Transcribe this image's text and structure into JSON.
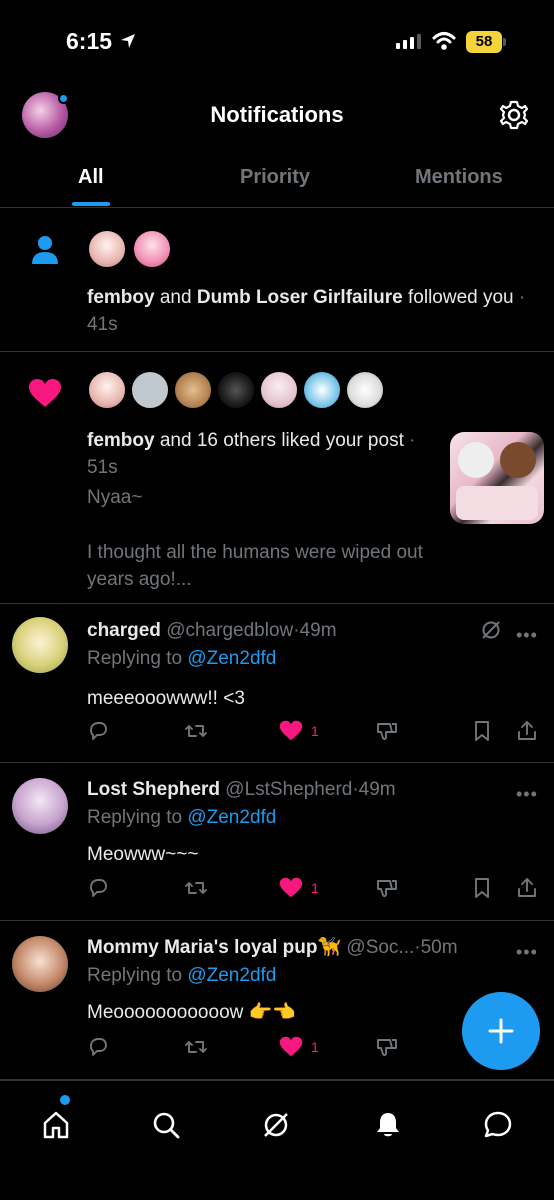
{
  "status_bar": {
    "time": "6:15",
    "battery": "58"
  },
  "header": {
    "title": "Notifications"
  },
  "tabs": [
    {
      "label": "All",
      "active": true
    },
    {
      "label": "Priority",
      "active": false
    },
    {
      "label": "Mentions",
      "active": false
    }
  ],
  "notifications": [
    {
      "type": "follow",
      "icon": "person-icon",
      "actor1": "femboy",
      "connector": " and ",
      "actor2": "Dumb Loser Girlfailure",
      "action": " followed you",
      "time": " · 41s"
    },
    {
      "type": "like",
      "icon": "heart-icon",
      "actor1": "femboy",
      "action": " and 16 others liked your post",
      "time": " · 51s",
      "post_text_1": "Nyaa~",
      "post_text_2": "I thought all the humans were wiped out years ago!..."
    }
  ],
  "replies": [
    {
      "name": "charged",
      "handle": "@chargedblow",
      "time": "·49m",
      "replying_label": "Replying to ",
      "replying_to": "@Zen2dfd",
      "text": "meeeooowww!! <3",
      "likes": "1"
    },
    {
      "name": "Lost Shepherd",
      "handle": "@LstShepherd",
      "time": "·49m",
      "replying_label": "Replying to ",
      "replying_to": "@Zen2dfd",
      "text": "Meowww~~~",
      "likes": "1"
    },
    {
      "name": "Mommy Maria's loyal pup🦮",
      "handle": "@Soc...",
      "time": "·50m",
      "replying_label": "Replying to ",
      "replying_to": "@Zen2dfd",
      "text": "Meooooooooooow 👉👈",
      "likes": "1"
    }
  ],
  "bottom_nav": [
    "home-icon",
    "search-icon",
    "grok-icon",
    "notifications-icon",
    "messages-icon"
  ],
  "colors": {
    "accent": "#1d9bf0",
    "like": "#f91880",
    "muted": "#71767b",
    "divider": "#2f3336"
  }
}
